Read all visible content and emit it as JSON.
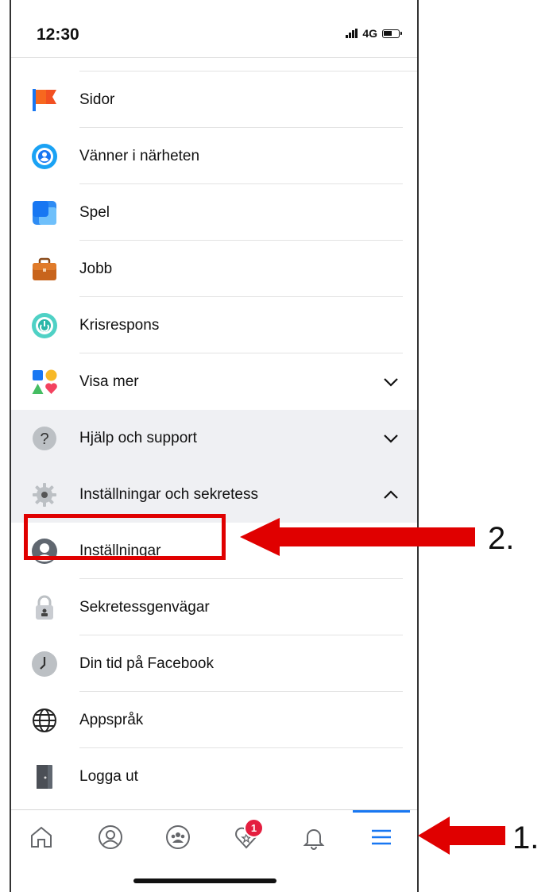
{
  "status_bar": {
    "time": "12:30",
    "network": "4G"
  },
  "menu": {
    "items": [
      {
        "label": "Sidor",
        "icon": "flag-icon",
        "bg": "white"
      },
      {
        "label": "Vänner i närheten",
        "icon": "nearby-friends-icon",
        "bg": "white"
      },
      {
        "label": "Spel",
        "icon": "games-icon",
        "bg": "white"
      },
      {
        "label": "Jobb",
        "icon": "briefcase-icon",
        "bg": "white"
      },
      {
        "label": "Krisrespons",
        "icon": "crisis-response-icon",
        "bg": "white"
      },
      {
        "label": "Visa mer",
        "icon": "shapes-icon",
        "bg": "white",
        "chevron": "down"
      },
      {
        "label": "Hjälp och support",
        "icon": "question-icon",
        "bg": "gray",
        "chevron": "down"
      },
      {
        "label": "Inställningar och sekretess",
        "icon": "gear-icon",
        "bg": "gray",
        "chevron": "up"
      },
      {
        "label": "Inställningar",
        "icon": "person-icon",
        "bg": "white"
      },
      {
        "label": "Sekretessgenvägar",
        "icon": "lock-icon",
        "bg": "white"
      },
      {
        "label": "Din tid på Facebook",
        "icon": "clock-icon",
        "bg": "white"
      },
      {
        "label": "Appspråk",
        "icon": "globe-icon",
        "bg": "white"
      },
      {
        "label": "Logga ut",
        "icon": "door-icon",
        "bg": "white"
      }
    ]
  },
  "tab_bar": {
    "tabs": [
      "home-icon",
      "profile-icon",
      "groups-icon",
      "dating-icon",
      "bell-icon",
      "menu-icon"
    ],
    "badge_count": "1",
    "active": "menu-icon"
  },
  "annotations": {
    "step1": "1.",
    "step2": "2."
  },
  "colors": {
    "accent": "#1877f2",
    "highlight": "#e00000",
    "badge": "#e41e3f"
  }
}
